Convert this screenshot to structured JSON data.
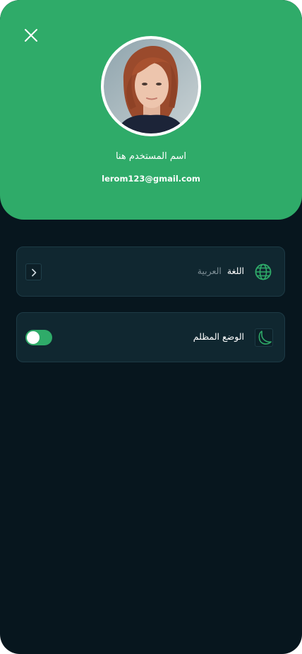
{
  "profile": {
    "name": "اسم المستخدم هنا",
    "email": "lerom123@gmail.com"
  },
  "settings": {
    "language": {
      "label": "اللغة",
      "value": "العربية",
      "icon": "globe-icon"
    },
    "dark_mode": {
      "label": "الوضع المظلم",
      "icon": "moon-icon",
      "enabled": true
    }
  },
  "colors": {
    "accent": "#2fab69",
    "background": "#07161e",
    "card": "#102730"
  }
}
